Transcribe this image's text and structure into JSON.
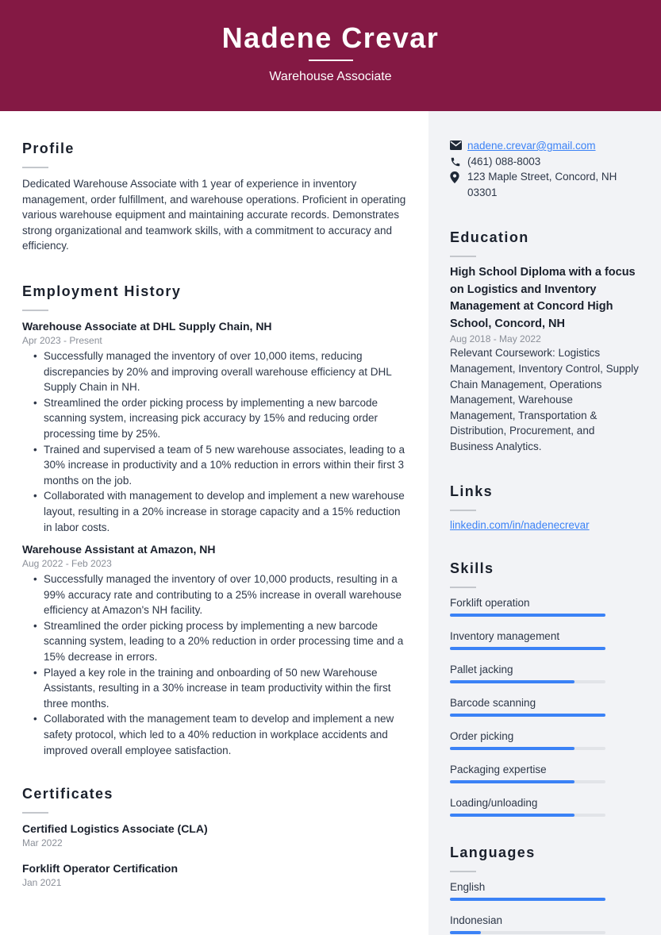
{
  "header": {
    "name": "Nadene Crevar",
    "title": "Warehouse Associate",
    "accent_color": "#841944"
  },
  "profile": {
    "heading": "Profile",
    "text": "Dedicated Warehouse Associate with 1 year of experience in inventory management, order fulfillment, and warehouse operations. Proficient in operating various warehouse equipment and maintaining accurate records. Demonstrates strong organizational and teamwork skills, with a commitment to accuracy and efficiency."
  },
  "employment": {
    "heading": "Employment History",
    "jobs": [
      {
        "title": "Warehouse Associate at DHL Supply Chain, NH",
        "dates": "Apr 2023 - Present",
        "bullets": [
          "Successfully managed the inventory of over 10,000 items, reducing discrepancies by 20% and improving overall warehouse efficiency at DHL Supply Chain in NH.",
          "Streamlined the order picking process by implementing a new barcode scanning system, increasing pick accuracy by 15% and reducing order processing time by 25%.",
          "Trained and supervised a team of 5 new warehouse associates, leading to a 30% increase in productivity and a 10% reduction in errors within their first 3 months on the job.",
          "Collaborated with management to develop and implement a new warehouse layout, resulting in a 20% increase in storage capacity and a 15% reduction in labor costs."
        ]
      },
      {
        "title": "Warehouse Assistant at Amazon, NH",
        "dates": "Aug 2022 - Feb 2023",
        "bullets": [
          "Successfully managed the inventory of over 10,000 products, resulting in a 99% accuracy rate and contributing to a 25% increase in overall warehouse efficiency at Amazon's NH facility.",
          "Streamlined the order picking process by implementing a new barcode scanning system, leading to a 20% reduction in order processing time and a 15% decrease in errors.",
          "Played a key role in the training and onboarding of 50 new Warehouse Assistants, resulting in a 30% increase in team productivity within the first three months.",
          "Collaborated with the management team to develop and implement a new safety protocol, which led to a 40% reduction in workplace accidents and improved overall employee satisfaction."
        ]
      }
    ]
  },
  "certificates": {
    "heading": "Certificates",
    "items": [
      {
        "name": "Certified Logistics Associate (CLA)",
        "date": "Mar 2022"
      },
      {
        "name": "Forklift Operator Certification",
        "date": "Jan 2021"
      }
    ]
  },
  "contact": {
    "email": "nadene.crevar@gmail.com",
    "phone": "(461) 088-8003",
    "address": "123 Maple Street, Concord, NH 03301",
    "icons": {
      "email": "envelope-icon",
      "phone": "phone-icon",
      "address": "map-pin-icon"
    }
  },
  "education": {
    "heading": "Education",
    "degree": "High School Diploma with a focus on Logistics and Inventory Management at Concord High School, Concord, NH",
    "dates": "Aug 2018 - May 2022",
    "description": "Relevant Coursework: Logistics Management, Inventory Control, Supply Chain Management, Operations Management, Warehouse Management, Transportation & Distribution, Procurement, and Business Analytics."
  },
  "links": {
    "heading": "Links",
    "items": [
      "linkedin.com/in/nadenecrevar"
    ]
  },
  "skills": {
    "heading": "Skills",
    "bar_color": "#3b82f6",
    "items": [
      {
        "name": "Forklift operation",
        "level": 1.0
      },
      {
        "name": "Inventory management",
        "level": 1.0
      },
      {
        "name": "Pallet jacking",
        "level": 0.8
      },
      {
        "name": "Barcode scanning",
        "level": 1.0
      },
      {
        "name": "Order picking",
        "level": 0.8
      },
      {
        "name": "Packaging expertise",
        "level": 0.8
      },
      {
        "name": "Loading/unloading",
        "level": 0.8
      }
    ]
  },
  "languages": {
    "heading": "Languages",
    "items": [
      {
        "name": "English",
        "level": 1.0
      },
      {
        "name": "Indonesian",
        "level": 0.2
      }
    ]
  }
}
